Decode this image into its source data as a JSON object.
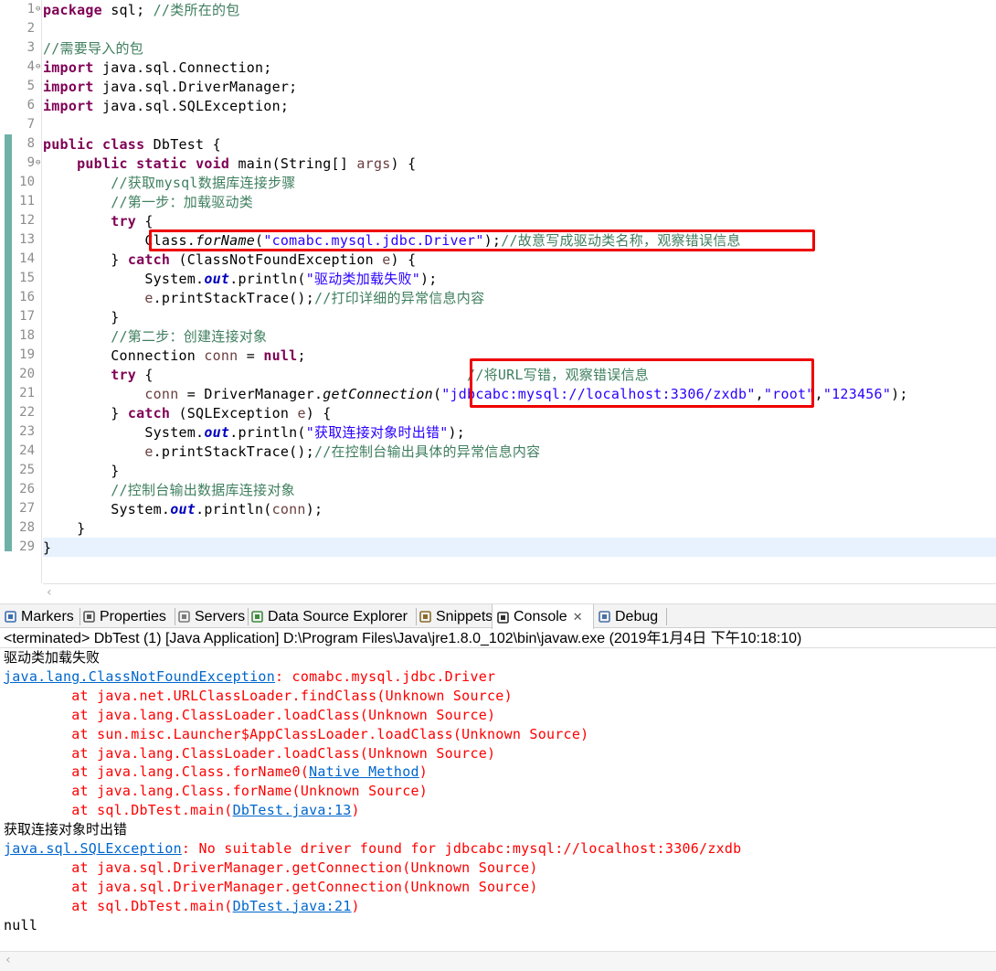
{
  "editor": {
    "lines": [
      {
        "n": "1",
        "fold": "⊖",
        "segs": [
          {
            "t": "package",
            "c": "kw"
          },
          {
            "t": " sql; "
          },
          {
            "t": "//类所在的包",
            "c": "cm"
          }
        ]
      },
      {
        "n": "2",
        "segs": []
      },
      {
        "n": "3",
        "segs": [
          {
            "t": "//需要导入的包",
            "c": "cm"
          }
        ]
      },
      {
        "n": "4",
        "fold": "⊖",
        "segs": [
          {
            "t": "import",
            "c": "kw"
          },
          {
            "t": " java.sql.Connection;"
          }
        ]
      },
      {
        "n": "5",
        "segs": [
          {
            "t": "import",
            "c": "kw"
          },
          {
            "t": " java.sql.DriverManager;"
          }
        ]
      },
      {
        "n": "6",
        "segs": [
          {
            "t": "import",
            "c": "kw"
          },
          {
            "t": " java.sql.SQLException;"
          }
        ]
      },
      {
        "n": "7",
        "segs": []
      },
      {
        "n": "8",
        "segs": [
          {
            "t": "public",
            "c": "kw"
          },
          {
            "t": " "
          },
          {
            "t": "class",
            "c": "kw"
          },
          {
            "t": " DbTest {"
          }
        ]
      },
      {
        "n": "9",
        "fold": "⊖",
        "segs": [
          {
            "t": "    "
          },
          {
            "t": "public",
            "c": "kw"
          },
          {
            "t": " "
          },
          {
            "t": "static",
            "c": "kw"
          },
          {
            "t": " "
          },
          {
            "t": "void",
            "c": "kw"
          },
          {
            "t": " main(String[] "
          },
          {
            "t": "args",
            "c": "var"
          },
          {
            "t": ") {"
          }
        ]
      },
      {
        "n": "10",
        "segs": [
          {
            "t": "        "
          },
          {
            "t": "//获取mysql数据库连接步骤",
            "c": "cm"
          }
        ]
      },
      {
        "n": "11",
        "segs": [
          {
            "t": "        "
          },
          {
            "t": "//第一步：加载驱动类",
            "c": "cm"
          }
        ]
      },
      {
        "n": "12",
        "segs": [
          {
            "t": "        "
          },
          {
            "t": "try",
            "c": "kw"
          },
          {
            "t": " {"
          }
        ]
      },
      {
        "n": "13",
        "segs": [
          {
            "t": "            Class."
          },
          {
            "t": "forName",
            "c": "itl"
          },
          {
            "t": "("
          },
          {
            "t": "\"comabc.mysql.jdbc.Driver\"",
            "c": "st"
          },
          {
            "t": ");"
          },
          {
            "t": "//故意写成驱动类名称，观察错误信息",
            "c": "cm"
          }
        ]
      },
      {
        "n": "14",
        "segs": [
          {
            "t": "        } "
          },
          {
            "t": "catch",
            "c": "kw"
          },
          {
            "t": " (ClassNotFoundException "
          },
          {
            "t": "e",
            "c": "var"
          },
          {
            "t": ") {"
          }
        ]
      },
      {
        "n": "15",
        "segs": [
          {
            "t": "            System."
          },
          {
            "t": "out",
            "c": "fld"
          },
          {
            "t": ".println("
          },
          {
            "t": "\"驱动类加载失败\"",
            "c": "st"
          },
          {
            "t": ");"
          }
        ]
      },
      {
        "n": "16",
        "segs": [
          {
            "t": "            "
          },
          {
            "t": "e",
            "c": "var"
          },
          {
            "t": ".printStackTrace();"
          },
          {
            "t": "//打印详细的异常信息内容",
            "c": "cm"
          }
        ]
      },
      {
        "n": "17",
        "segs": [
          {
            "t": "        }"
          }
        ]
      },
      {
        "n": "18",
        "segs": [
          {
            "t": "        "
          },
          {
            "t": "//第二步：创建连接对象",
            "c": "cm"
          }
        ]
      },
      {
        "n": "19",
        "segs": [
          {
            "t": "        Connection "
          },
          {
            "t": "conn",
            "c": "var"
          },
          {
            "t": " = "
          },
          {
            "t": "null",
            "c": "kw"
          },
          {
            "t": ";"
          }
        ]
      },
      {
        "n": "20",
        "segs": [
          {
            "t": "        "
          },
          {
            "t": "try",
            "c": "kw"
          },
          {
            "t": " {                                     "
          },
          {
            "t": "//将URL写错，观察错误信息",
            "c": "cm"
          }
        ]
      },
      {
        "n": "21",
        "segs": [
          {
            "t": "            "
          },
          {
            "t": "conn",
            "c": "var"
          },
          {
            "t": " = DriverManager."
          },
          {
            "t": "getConnection",
            "c": "itl"
          },
          {
            "t": "("
          },
          {
            "t": "\"jdbcabc:mysql://localhost:3306/zxdb\"",
            "c": "st"
          },
          {
            "t": ","
          },
          {
            "t": "\"root\"",
            "c": "st"
          },
          {
            "t": ","
          },
          {
            "t": "\"123456\"",
            "c": "st"
          },
          {
            "t": ");"
          }
        ]
      },
      {
        "n": "22",
        "segs": [
          {
            "t": "        } "
          },
          {
            "t": "catch",
            "c": "kw"
          },
          {
            "t": " (SQLException "
          },
          {
            "t": "e",
            "c": "var"
          },
          {
            "t": ") {"
          }
        ]
      },
      {
        "n": "23",
        "segs": [
          {
            "t": "            System."
          },
          {
            "t": "out",
            "c": "fld"
          },
          {
            "t": ".println("
          },
          {
            "t": "\"获取连接对象时出错\"",
            "c": "st"
          },
          {
            "t": ");"
          }
        ]
      },
      {
        "n": "24",
        "segs": [
          {
            "t": "            "
          },
          {
            "t": "e",
            "c": "var"
          },
          {
            "t": ".printStackTrace();"
          },
          {
            "t": "//在控制台输出具体的异常信息内容",
            "c": "cm"
          }
        ]
      },
      {
        "n": "25",
        "segs": [
          {
            "t": "        }"
          }
        ]
      },
      {
        "n": "26",
        "segs": [
          {
            "t": "        "
          },
          {
            "t": "//控制台输出数据库连接对象",
            "c": "cm"
          }
        ]
      },
      {
        "n": "27",
        "segs": [
          {
            "t": "        System."
          },
          {
            "t": "out",
            "c": "fld"
          },
          {
            "t": ".println("
          },
          {
            "t": "conn",
            "c": "var"
          },
          {
            "t": ");"
          }
        ]
      },
      {
        "n": "28",
        "segs": [
          {
            "t": "    }"
          }
        ]
      },
      {
        "n": "29",
        "segs": [
          {
            "t": "}"
          }
        ]
      }
    ]
  },
  "view_tabs": [
    {
      "label": "Markers",
      "icon": "markers-icon"
    },
    {
      "label": "Properties",
      "icon": "properties-icon"
    },
    {
      "label": "Servers",
      "icon": "servers-icon"
    },
    {
      "label": "Data Source Explorer",
      "icon": "data-source-explorer-icon"
    },
    {
      "label": "Snippets",
      "icon": "snippets-icon"
    },
    {
      "label": "Console",
      "icon": "console-icon",
      "active": true,
      "close": "✕"
    },
    {
      "label": "Debug",
      "icon": "debug-icon"
    }
  ],
  "console": {
    "status": "<terminated> DbTest (1) [Java Application] D:\\Program Files\\Java\\jre1.8.0_102\\bin\\javaw.exe (2019年1月4日 下午10:18:10)",
    "lines": [
      {
        "segs": [
          {
            "t": "驱动类加载失败",
            "c": "out cjk"
          }
        ]
      },
      {
        "segs": [
          {
            "t": "java.lang.ClassNotFoundException",
            "c": "lnk"
          },
          {
            "t": ": comabc.mysql.jdbc.Driver",
            "c": "err"
          }
        ]
      },
      {
        "segs": [
          {
            "t": "\tat java.net.URLClassLoader.findClass(Unknown Source)",
            "c": "err"
          }
        ]
      },
      {
        "segs": [
          {
            "t": "\tat java.lang.ClassLoader.loadClass(Unknown Source)",
            "c": "err"
          }
        ]
      },
      {
        "segs": [
          {
            "t": "\tat sun.misc.Launcher$AppClassLoader.loadClass(Unknown Source)",
            "c": "err"
          }
        ]
      },
      {
        "segs": [
          {
            "t": "\tat java.lang.ClassLoader.loadClass(Unknown Source)",
            "c": "err"
          }
        ]
      },
      {
        "segs": [
          {
            "t": "\tat java.lang.Class.forName0(",
            "c": "err"
          },
          {
            "t": "Native Method",
            "c": "lnk"
          },
          {
            "t": ")",
            "c": "err"
          }
        ]
      },
      {
        "segs": [
          {
            "t": "\tat java.lang.Class.forName(Unknown Source)",
            "c": "err"
          }
        ]
      },
      {
        "segs": [
          {
            "t": "\tat sql.DbTest.main(",
            "c": "err"
          },
          {
            "t": "DbTest.java:13",
            "c": "lnk"
          },
          {
            "t": ")",
            "c": "err"
          }
        ]
      },
      {
        "segs": [
          {
            "t": "获取连接对象时出错",
            "c": "out cjk"
          }
        ]
      },
      {
        "segs": [
          {
            "t": "java.sql.SQLException",
            "c": "lnk"
          },
          {
            "t": ": No suitable driver found for jdbcabc:mysql://localhost:3306/zxdb",
            "c": "err"
          }
        ]
      },
      {
        "segs": [
          {
            "t": "\tat java.sql.DriverManager.getConnection(Unknown Source)",
            "c": "err"
          }
        ]
      },
      {
        "segs": [
          {
            "t": "\tat java.sql.DriverManager.getConnection(Unknown Source)",
            "c": "err"
          }
        ]
      },
      {
        "segs": [
          {
            "t": "\tat sql.DbTest.main(",
            "c": "err"
          },
          {
            "t": "DbTest.java:21",
            "c": "lnk"
          },
          {
            "t": ")",
            "c": "err"
          }
        ]
      },
      {
        "segs": [
          {
            "t": "null",
            "c": "out"
          }
        ]
      }
    ]
  },
  "colors": {
    "keyword": "#7f0055",
    "comment": "#3f7f5f",
    "string": "#2a00ff",
    "error": "#ff0000",
    "link": "#0066cc",
    "highlight_box": "#ee0000",
    "current_line": "#e8f2fe"
  }
}
